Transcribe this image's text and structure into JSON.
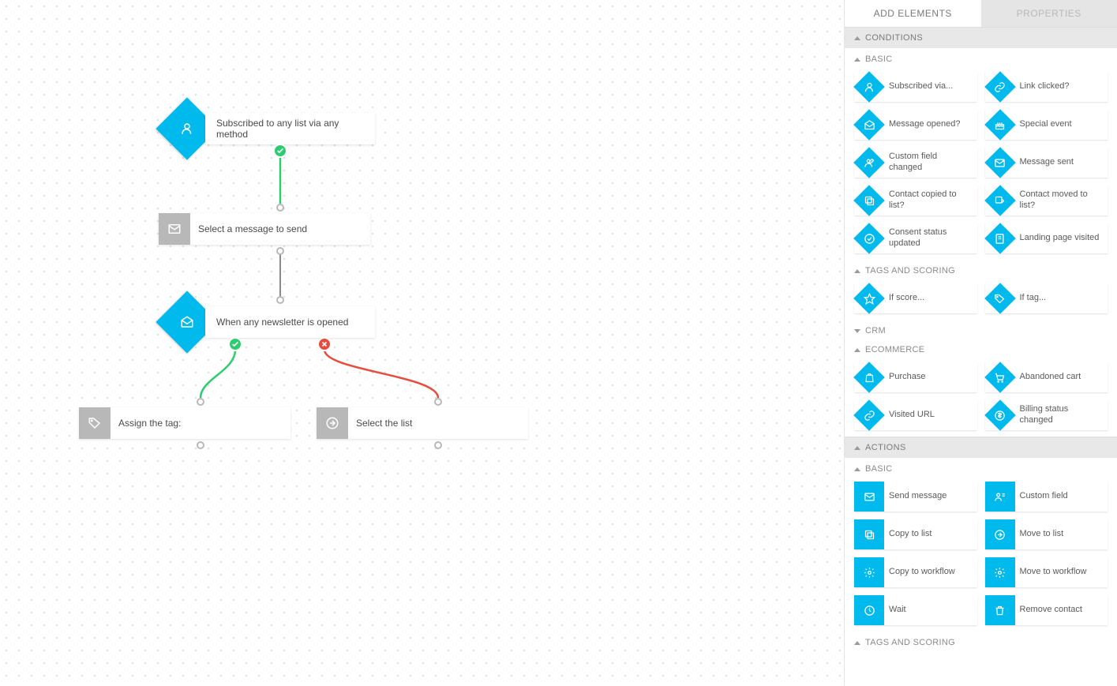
{
  "tabs": {
    "add": "ADD ELEMENTS",
    "props": "PROPERTIES"
  },
  "sections": {
    "conditions": "CONDITIONS",
    "actions": "ACTIONS",
    "basic": "BASIC",
    "tags_scoring": "TAGS AND SCORING",
    "crm": "CRM",
    "ecommerce": "ECOMMERCE"
  },
  "cond": {
    "basic": [
      {
        "l": "Subscribed via..."
      },
      {
        "l": "Link clicked?"
      },
      {
        "l": "Message opened?"
      },
      {
        "l": "Special event"
      },
      {
        "l": "Custom field changed"
      },
      {
        "l": "Message sent"
      },
      {
        "l": "Contact copied to list?"
      },
      {
        "l": "Contact moved to list?"
      },
      {
        "l": "Consent status updated"
      },
      {
        "l": "Landing page visited"
      }
    ],
    "tags": [
      {
        "l": "If score..."
      },
      {
        "l": "If tag..."
      }
    ],
    "ecom": [
      {
        "l": "Purchase"
      },
      {
        "l": "Abandoned cart"
      },
      {
        "l": "Visited URL"
      },
      {
        "l": "Billing status changed"
      }
    ]
  },
  "act": {
    "basic": [
      {
        "l": "Send message"
      },
      {
        "l": "Custom field"
      },
      {
        "l": "Copy to list"
      },
      {
        "l": "Move to list"
      },
      {
        "l": "Copy to workflow"
      },
      {
        "l": "Move to workflow"
      },
      {
        "l": "Wait"
      },
      {
        "l": "Remove contact"
      }
    ]
  },
  "canvas": {
    "n1": "Subscribed to any list via any method",
    "n2": "Select a message to send",
    "n3": "When any newsletter is opened",
    "n4": "Assign the tag:",
    "n5": "Select the list"
  }
}
